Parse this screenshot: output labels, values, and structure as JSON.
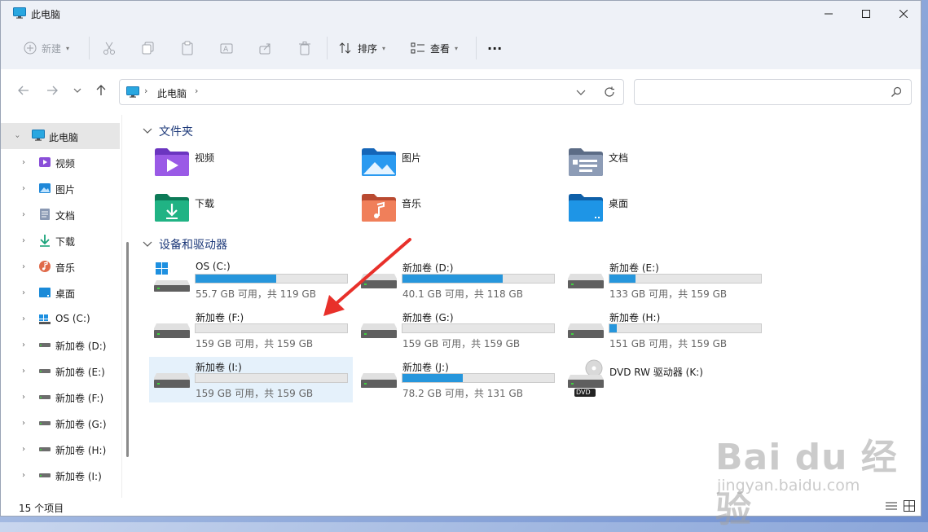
{
  "window": {
    "title": "此电脑"
  },
  "toolbar": {
    "new_label": "新建",
    "sort_label": "排序",
    "view_label": "查看",
    "more_label": "···"
  },
  "address": {
    "crumb": "此电脑"
  },
  "sidebar": {
    "items": [
      {
        "label": "此电脑",
        "icon": "pc-icon"
      },
      {
        "label": "视频",
        "icon": "video-icon"
      },
      {
        "label": "图片",
        "icon": "pictures-icon"
      },
      {
        "label": "文档",
        "icon": "documents-icon"
      },
      {
        "label": "下载",
        "icon": "download-icon"
      },
      {
        "label": "音乐",
        "icon": "music-icon"
      },
      {
        "label": "桌面",
        "icon": "desktop-icon"
      },
      {
        "label": "OS (C:)",
        "icon": "windows-drive-icon"
      },
      {
        "label": "新加卷 (D:)",
        "icon": "drive-icon"
      },
      {
        "label": "新加卷 (E:)",
        "icon": "drive-icon"
      },
      {
        "label": "新加卷 (F:)",
        "icon": "drive-icon"
      },
      {
        "label": "新加卷 (G:)",
        "icon": "drive-icon"
      },
      {
        "label": "新加卷 (H:)",
        "icon": "drive-icon"
      },
      {
        "label": "新加卷 (I:)",
        "icon": "drive-icon"
      }
    ]
  },
  "groups": {
    "folders": "文件夹",
    "drives": "设备和驱动器"
  },
  "folders": [
    {
      "label": "视频",
      "icon": "video-folder-icon",
      "color": "#8a4fd8"
    },
    {
      "label": "图片",
      "icon": "pictures-folder-icon",
      "color": "#1f88d8"
    },
    {
      "label": "文档",
      "icon": "documents-folder-icon",
      "color": "#7f8ea8"
    },
    {
      "label": "下载",
      "icon": "download-folder-icon",
      "color": "#1aa37a"
    },
    {
      "label": "音乐",
      "icon": "music-folder-icon",
      "color": "#e06a4a"
    },
    {
      "label": "桌面",
      "icon": "desktop-folder-icon",
      "color": "#1a8ad8"
    }
  ],
  "drives": [
    {
      "name": "OS (C:)",
      "size": "55.7 GB 可用，共 119 GB",
      "used": 0.53,
      "icon": "windows-drive-icon"
    },
    {
      "name": "新加卷 (D:)",
      "size": "40.1 GB 可用，共 118 GB",
      "used": 0.66,
      "icon": "drive-icon"
    },
    {
      "name": "新加卷 (E:)",
      "size": "133 GB 可用，共 159 GB",
      "used": 0.17,
      "icon": "drive-icon"
    },
    {
      "name": "新加卷 (F:)",
      "size": "159 GB 可用，共 159 GB",
      "used": 0.0,
      "icon": "drive-icon"
    },
    {
      "name": "新加卷 (G:)",
      "size": "159 GB 可用，共 159 GB",
      "used": 0.0,
      "icon": "drive-icon"
    },
    {
      "name": "新加卷 (H:)",
      "size": "151 GB 可用，共 159 GB",
      "used": 0.05,
      "icon": "drive-icon"
    },
    {
      "name": "新加卷 (I:)",
      "size": "159 GB 可用，共 159 GB",
      "used": 0.0,
      "icon": "drive-icon"
    },
    {
      "name": "新加卷 (J:)",
      "size": "78.2 GB 可用，共 131 GB",
      "used": 0.4,
      "icon": "drive-icon"
    }
  ],
  "dvd": {
    "name": "DVD RW 驱动器 (K:)",
    "badge": "DVD"
  },
  "status": {
    "count": "15 个项目"
  },
  "watermark": {
    "brand": "Bai du 经验",
    "url": "jingyan.baidu.com"
  },
  "colors": {
    "accent": "#2696dc",
    "selection": "#e5f1fb",
    "annotation": "#e8302a"
  }
}
